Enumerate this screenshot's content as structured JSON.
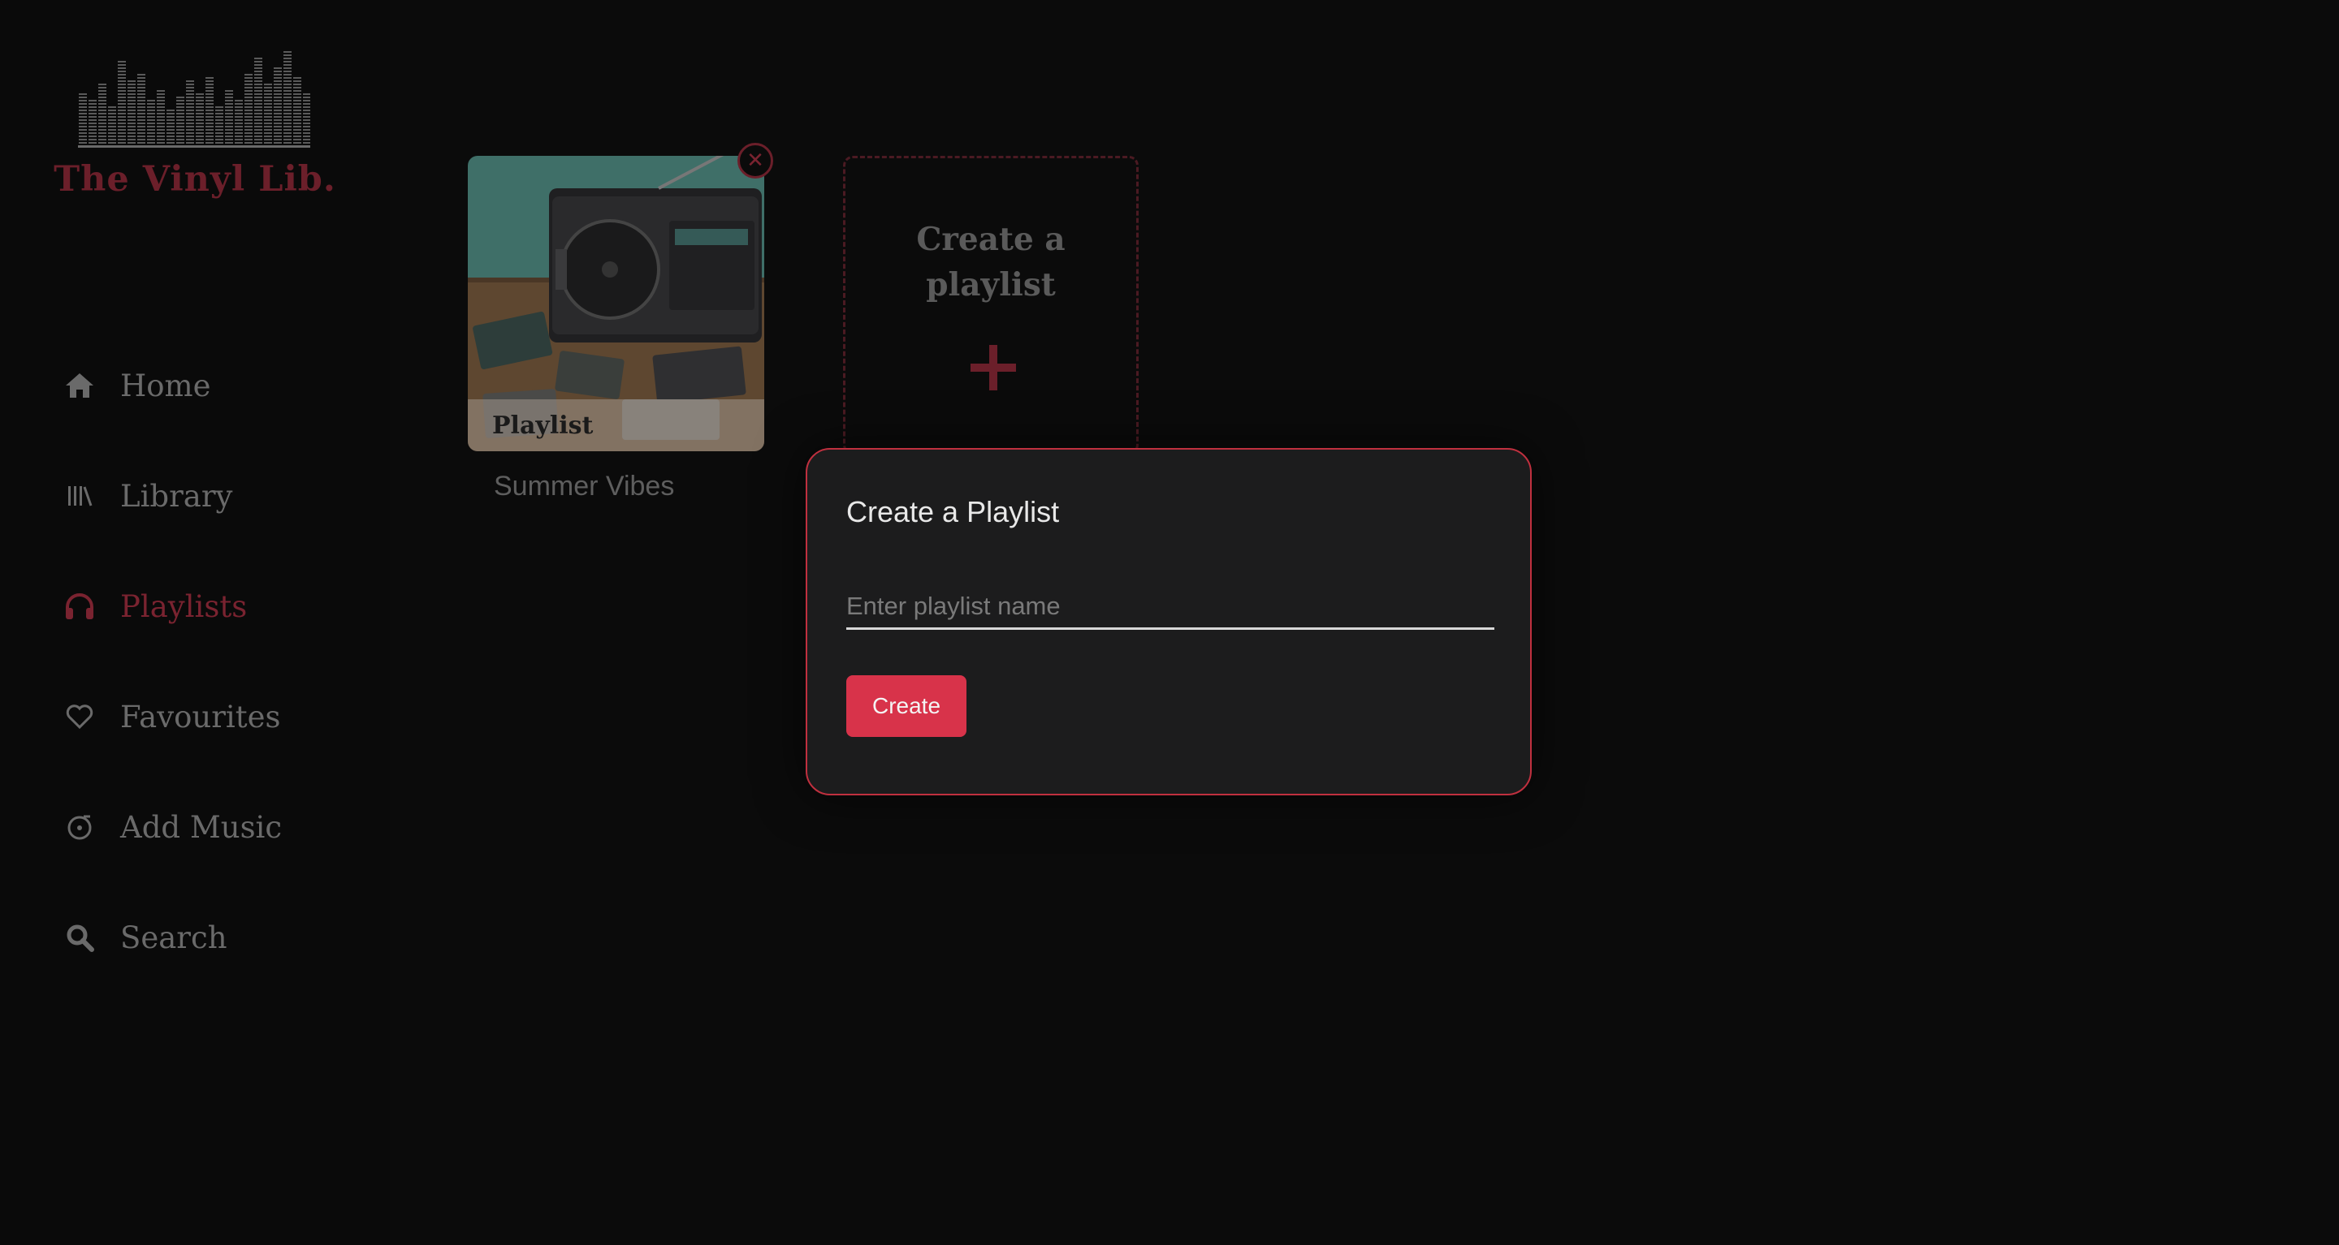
{
  "app": {
    "name": "The Vinyl Lib."
  },
  "colors": {
    "accent": "#d8334a",
    "accent_dim": "#7a2330",
    "background": "#0b0b0b",
    "modal_bg": "#1c1c1d"
  },
  "nav": {
    "items": [
      {
        "label": "Home",
        "icon": "home-icon",
        "active": false
      },
      {
        "label": "Library",
        "icon": "library-icon",
        "active": false
      },
      {
        "label": "Playlists",
        "icon": "headphones-icon",
        "active": true
      },
      {
        "label": "Favourites",
        "icon": "heart-icon",
        "active": false
      },
      {
        "label": "Add Music",
        "icon": "music-disc-icon",
        "active": false
      },
      {
        "label": "Search",
        "icon": "search-icon",
        "active": false
      }
    ]
  },
  "playlists": [
    {
      "badge": "Playlist",
      "name": "Summer Vibes"
    }
  ],
  "create_card": {
    "title": "Create a playlist",
    "icon": "plus-icon"
  },
  "modal": {
    "title": "Create a Playlist",
    "input_placeholder": "Enter playlist name",
    "input_value": "",
    "submit_label": "Create"
  }
}
